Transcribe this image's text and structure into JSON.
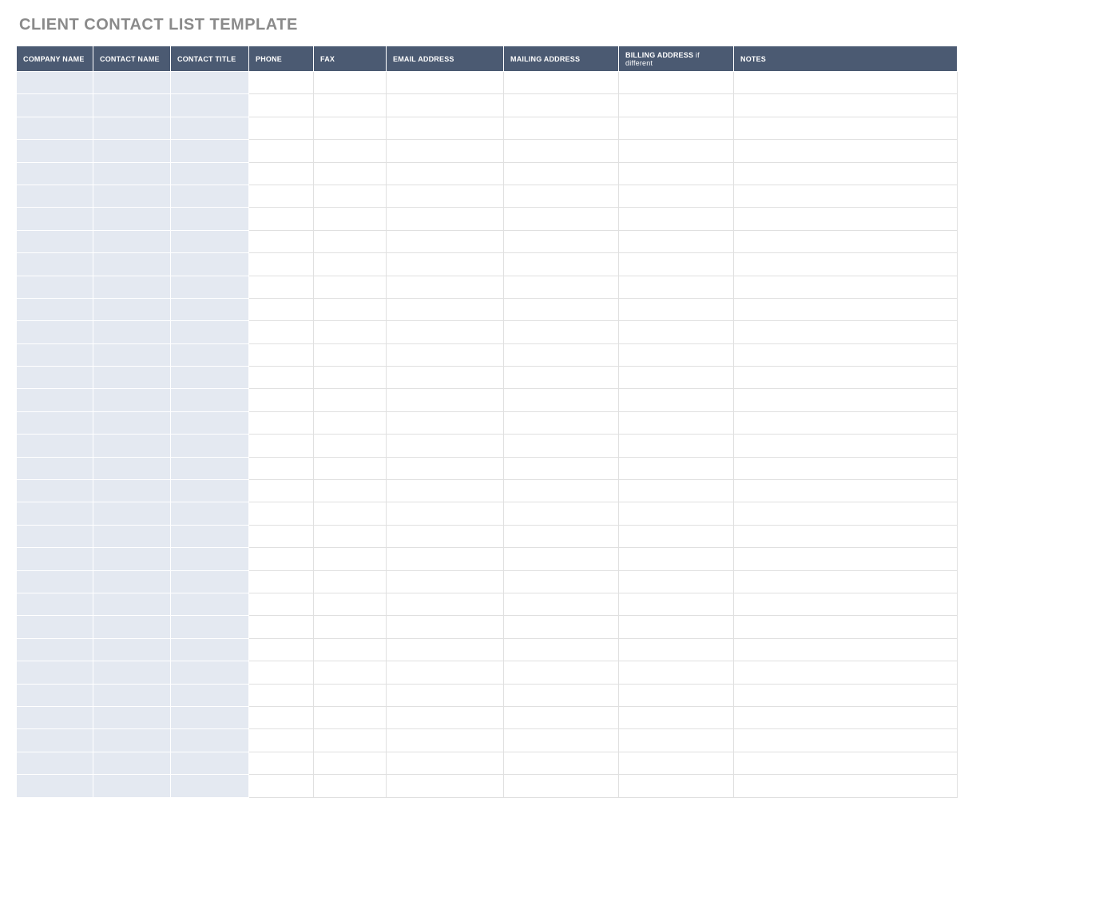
{
  "title": "CLIENT CONTACT LIST TEMPLATE",
  "columns": [
    {
      "label": "COMPANY NAME",
      "sub": ""
    },
    {
      "label": "CONTACT NAME",
      "sub": ""
    },
    {
      "label": "CONTACT TITLE",
      "sub": ""
    },
    {
      "label": "PHONE",
      "sub": ""
    },
    {
      "label": "FAX",
      "sub": ""
    },
    {
      "label": "EMAIL ADDRESS",
      "sub": ""
    },
    {
      "label": "MAILING ADDRESS",
      "sub": ""
    },
    {
      "label": "BILLING ADDRESS",
      "sub": " if different"
    },
    {
      "label": "NOTES",
      "sub": ""
    }
  ],
  "row_count": 32,
  "shaded_columns": [
    0,
    1,
    2
  ],
  "rows": [
    {
      "company_name": "",
      "contact_name": "",
      "contact_title": "",
      "phone": "",
      "fax": "",
      "email_address": "",
      "mailing_address": "",
      "billing_address": "",
      "notes": ""
    },
    {
      "company_name": "",
      "contact_name": "",
      "contact_title": "",
      "phone": "",
      "fax": "",
      "email_address": "",
      "mailing_address": "",
      "billing_address": "",
      "notes": ""
    },
    {
      "company_name": "",
      "contact_name": "",
      "contact_title": "",
      "phone": "",
      "fax": "",
      "email_address": "",
      "mailing_address": "",
      "billing_address": "",
      "notes": ""
    },
    {
      "company_name": "",
      "contact_name": "",
      "contact_title": "",
      "phone": "",
      "fax": "",
      "email_address": "",
      "mailing_address": "",
      "billing_address": "",
      "notes": ""
    },
    {
      "company_name": "",
      "contact_name": "",
      "contact_title": "",
      "phone": "",
      "fax": "",
      "email_address": "",
      "mailing_address": "",
      "billing_address": "",
      "notes": ""
    },
    {
      "company_name": "",
      "contact_name": "",
      "contact_title": "",
      "phone": "",
      "fax": "",
      "email_address": "",
      "mailing_address": "",
      "billing_address": "",
      "notes": ""
    },
    {
      "company_name": "",
      "contact_name": "",
      "contact_title": "",
      "phone": "",
      "fax": "",
      "email_address": "",
      "mailing_address": "",
      "billing_address": "",
      "notes": ""
    },
    {
      "company_name": "",
      "contact_name": "",
      "contact_title": "",
      "phone": "",
      "fax": "",
      "email_address": "",
      "mailing_address": "",
      "billing_address": "",
      "notes": ""
    },
    {
      "company_name": "",
      "contact_name": "",
      "contact_title": "",
      "phone": "",
      "fax": "",
      "email_address": "",
      "mailing_address": "",
      "billing_address": "",
      "notes": ""
    },
    {
      "company_name": "",
      "contact_name": "",
      "contact_title": "",
      "phone": "",
      "fax": "",
      "email_address": "",
      "mailing_address": "",
      "billing_address": "",
      "notes": ""
    },
    {
      "company_name": "",
      "contact_name": "",
      "contact_title": "",
      "phone": "",
      "fax": "",
      "email_address": "",
      "mailing_address": "",
      "billing_address": "",
      "notes": ""
    },
    {
      "company_name": "",
      "contact_name": "",
      "contact_title": "",
      "phone": "",
      "fax": "",
      "email_address": "",
      "mailing_address": "",
      "billing_address": "",
      "notes": ""
    },
    {
      "company_name": "",
      "contact_name": "",
      "contact_title": "",
      "phone": "",
      "fax": "",
      "email_address": "",
      "mailing_address": "",
      "billing_address": "",
      "notes": ""
    },
    {
      "company_name": "",
      "contact_name": "",
      "contact_title": "",
      "phone": "",
      "fax": "",
      "email_address": "",
      "mailing_address": "",
      "billing_address": "",
      "notes": ""
    },
    {
      "company_name": "",
      "contact_name": "",
      "contact_title": "",
      "phone": "",
      "fax": "",
      "email_address": "",
      "mailing_address": "",
      "billing_address": "",
      "notes": ""
    },
    {
      "company_name": "",
      "contact_name": "",
      "contact_title": "",
      "phone": "",
      "fax": "",
      "email_address": "",
      "mailing_address": "",
      "billing_address": "",
      "notes": ""
    },
    {
      "company_name": "",
      "contact_name": "",
      "contact_title": "",
      "phone": "",
      "fax": "",
      "email_address": "",
      "mailing_address": "",
      "billing_address": "",
      "notes": ""
    },
    {
      "company_name": "",
      "contact_name": "",
      "contact_title": "",
      "phone": "",
      "fax": "",
      "email_address": "",
      "mailing_address": "",
      "billing_address": "",
      "notes": ""
    },
    {
      "company_name": "",
      "contact_name": "",
      "contact_title": "",
      "phone": "",
      "fax": "",
      "email_address": "",
      "mailing_address": "",
      "billing_address": "",
      "notes": ""
    },
    {
      "company_name": "",
      "contact_name": "",
      "contact_title": "",
      "phone": "",
      "fax": "",
      "email_address": "",
      "mailing_address": "",
      "billing_address": "",
      "notes": ""
    },
    {
      "company_name": "",
      "contact_name": "",
      "contact_title": "",
      "phone": "",
      "fax": "",
      "email_address": "",
      "mailing_address": "",
      "billing_address": "",
      "notes": ""
    },
    {
      "company_name": "",
      "contact_name": "",
      "contact_title": "",
      "phone": "",
      "fax": "",
      "email_address": "",
      "mailing_address": "",
      "billing_address": "",
      "notes": ""
    },
    {
      "company_name": "",
      "contact_name": "",
      "contact_title": "",
      "phone": "",
      "fax": "",
      "email_address": "",
      "mailing_address": "",
      "billing_address": "",
      "notes": ""
    },
    {
      "company_name": "",
      "contact_name": "",
      "contact_title": "",
      "phone": "",
      "fax": "",
      "email_address": "",
      "mailing_address": "",
      "billing_address": "",
      "notes": ""
    },
    {
      "company_name": "",
      "contact_name": "",
      "contact_title": "",
      "phone": "",
      "fax": "",
      "email_address": "",
      "mailing_address": "",
      "billing_address": "",
      "notes": ""
    },
    {
      "company_name": "",
      "contact_name": "",
      "contact_title": "",
      "phone": "",
      "fax": "",
      "email_address": "",
      "mailing_address": "",
      "billing_address": "",
      "notes": ""
    },
    {
      "company_name": "",
      "contact_name": "",
      "contact_title": "",
      "phone": "",
      "fax": "",
      "email_address": "",
      "mailing_address": "",
      "billing_address": "",
      "notes": ""
    },
    {
      "company_name": "",
      "contact_name": "",
      "contact_title": "",
      "phone": "",
      "fax": "",
      "email_address": "",
      "mailing_address": "",
      "billing_address": "",
      "notes": ""
    },
    {
      "company_name": "",
      "contact_name": "",
      "contact_title": "",
      "phone": "",
      "fax": "",
      "email_address": "",
      "mailing_address": "",
      "billing_address": "",
      "notes": ""
    },
    {
      "company_name": "",
      "contact_name": "",
      "contact_title": "",
      "phone": "",
      "fax": "",
      "email_address": "",
      "mailing_address": "",
      "billing_address": "",
      "notes": ""
    },
    {
      "company_name": "",
      "contact_name": "",
      "contact_title": "",
      "phone": "",
      "fax": "",
      "email_address": "",
      "mailing_address": "",
      "billing_address": "",
      "notes": ""
    },
    {
      "company_name": "",
      "contact_name": "",
      "contact_title": "",
      "phone": "",
      "fax": "",
      "email_address": "",
      "mailing_address": "",
      "billing_address": "",
      "notes": ""
    }
  ]
}
